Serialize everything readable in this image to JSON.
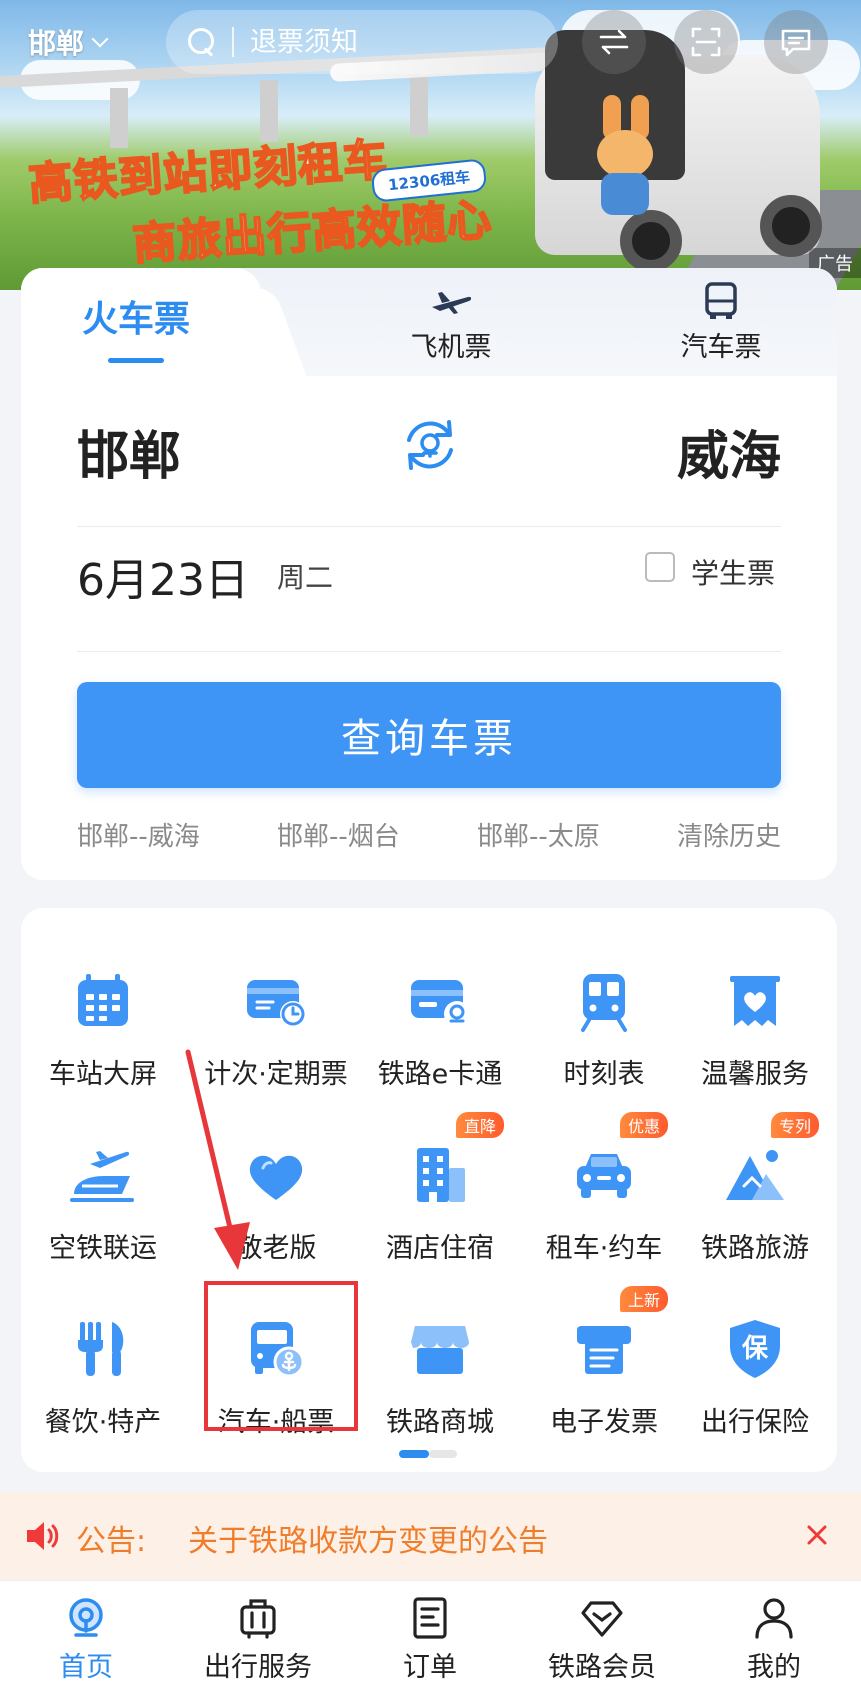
{
  "topbar": {
    "city": "邯郸",
    "search_placeholder": "退票须知"
  },
  "banner": {
    "headline_line1": "高铁到站即刻租车",
    "headline_line2": "商旅出行高效随心",
    "tag": "12306租车",
    "ad_label": "广告"
  },
  "tabs": {
    "train": "火车票",
    "flight": "飞机票",
    "bus": "汽车票"
  },
  "route": {
    "from": "邯郸",
    "to": "威海"
  },
  "date": {
    "main": "6月23日",
    "weekday": "周二",
    "student_label": "学生票",
    "student_checked": false
  },
  "query_button": "查询车票",
  "history": [
    "邯郸--威海",
    "邯郸--烟台",
    "邯郸--太原",
    "清除历史"
  ],
  "services": [
    {
      "label": "车站大屏",
      "icon": "calendar-icon",
      "badge": ""
    },
    {
      "label": "计次·定期票",
      "icon": "wallet-clock-icon",
      "badge": ""
    },
    {
      "label": "铁路e卡通",
      "icon": "card-icon",
      "badge": ""
    },
    {
      "label": "时刻表",
      "icon": "train-front-icon",
      "badge": ""
    },
    {
      "label": "温馨服务",
      "icon": "heart-banner-icon",
      "badge": ""
    },
    {
      "label": "空铁联运",
      "icon": "plane-train-icon",
      "badge": ""
    },
    {
      "label": "敬老版",
      "icon": "heart-icon",
      "badge": ""
    },
    {
      "label": "酒店住宿",
      "icon": "hotel-icon",
      "badge": "直降"
    },
    {
      "label": "租车·约车",
      "icon": "car-icon",
      "badge": "优惠"
    },
    {
      "label": "铁路旅游",
      "icon": "mountain-icon",
      "badge": "专列"
    },
    {
      "label": "餐饮·特产",
      "icon": "fork-knife-icon",
      "badge": ""
    },
    {
      "label": "汽车·船票",
      "icon": "bus-anchor-icon",
      "badge": ""
    },
    {
      "label": "铁路商城",
      "icon": "shop-icon",
      "badge": ""
    },
    {
      "label": "电子发票",
      "icon": "invoice-printer-icon",
      "badge": "上新"
    },
    {
      "label": "出行保险",
      "icon": "shield-bao-icon",
      "badge": ""
    }
  ],
  "insurance_glyph": "保",
  "notice": {
    "prefix": "公告:",
    "text": "关于铁路收款方变更的公告"
  },
  "nav": [
    {
      "label": "首页",
      "icon": "home-rail-icon",
      "active": true
    },
    {
      "label": "出行服务",
      "icon": "luggage-icon",
      "active": false
    },
    {
      "label": "订单",
      "icon": "order-doc-icon",
      "active": false
    },
    {
      "label": "铁路会员",
      "icon": "diamond-icon",
      "active": false
    },
    {
      "label": "我的",
      "icon": "person-icon",
      "active": false
    }
  ],
  "colors": {
    "primary": "#2d8cf0",
    "button": "#3f95f5",
    "notice_text": "#f07d2b",
    "highlight": "#e8373a"
  }
}
